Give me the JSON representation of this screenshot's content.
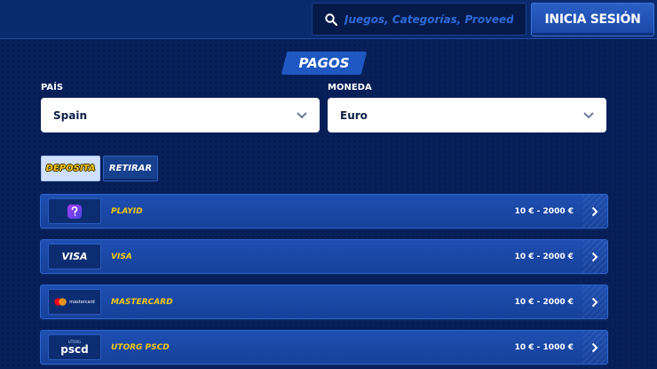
{
  "header": {
    "search_placeholder": "Juegos, Categorías, Proveedores",
    "login_label": "INICIA SESIÓN"
  },
  "page": {
    "title": "PAGOS"
  },
  "filters": {
    "country": {
      "label": "PAÍS",
      "value": "Spain"
    },
    "currency": {
      "label": "MONEDA",
      "value": "Euro"
    }
  },
  "tabs": {
    "deposit": "DEPOSITA",
    "withdraw": "RETIRAR"
  },
  "methods": [
    {
      "name": "PLAYID",
      "range": "10 € - 2000 €"
    },
    {
      "name": "VISA",
      "range": "10 € - 2000 €",
      "logo_text": "VISA"
    },
    {
      "name": "MASTERCARD",
      "range": "10 € - 2000 €",
      "logo_text": "mastercard"
    },
    {
      "name": "UTORG PSCD",
      "range": "10 € - 1000 €",
      "logo_small": "UTORG",
      "logo_big": "pscd"
    }
  ],
  "colors": {
    "background": "#07205a",
    "accent_yellow": "#f6c90e",
    "button_blue": "#1f58c2"
  }
}
